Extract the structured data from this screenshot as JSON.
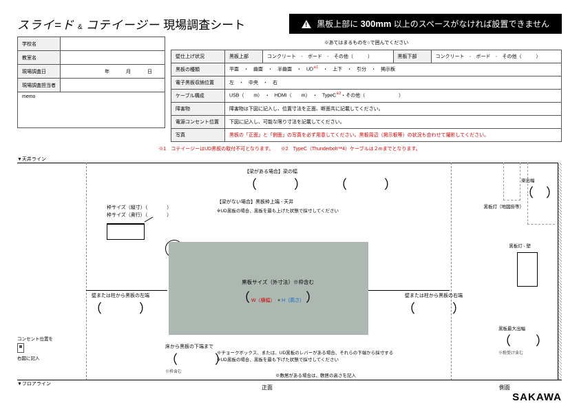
{
  "header": {
    "brand": "スライ=ド",
    "amp": "&",
    "brand2": "コテイージー",
    "subtitle": "現場調査シート",
    "warning_prefix": "黒板上部に",
    "warning_bold": "300mm",
    "warning_suffix": "以上のスペースがなければ設置できません"
  },
  "circle_note": "※あてはまるものを○で囲んでください",
  "left": {
    "school": "学校名",
    "room": "教室名",
    "date": "現場調査日",
    "y": "年",
    "m": "月",
    "d": "日",
    "person": "現場調査担当者",
    "memo": "memo"
  },
  "right": {
    "wall": "壁仕上げ状況",
    "board_top": "黒板上部",
    "board_bot": "黒板下部",
    "opt_concrete": "コンクリート",
    "opt_board": "ボード",
    "opt_other": "その他（",
    "board_type": "黒板の種類",
    "type_opts": "平面　・　曲面　・　半曲面　・　UD",
    "type_opts2": "・　上下　・　引分　・　掲示板",
    "elec": "電子黒板収納位置",
    "elec_opts": "左　・　中央　・　右",
    "cable": "ケーブル構成",
    "cable_opts": "USB（　　m）　・　HDMI（　　m）　・　TypeC",
    "cable_opts2": "・その他（",
    "obstacle": "障害物",
    "obstacle_text": "障害物は下図に記入し、位置寸法を正面、断面共に記載してください。",
    "outlet": "電源コンセント位置",
    "outlet_text": "下図に記入し、可能な限り寸法を記載してください。",
    "photo": "写真",
    "photo_text": "黒板の「正面」と「側面」の写真を必ず用意してください。黒板周辺（掲示板等）の状況も合わせて撮影してください。"
  },
  "fn1": "※1　コテイージーはUD黒板の取付不可となります。",
  "fn2": "※2　TypeC（Thunderbolt™4）ケーブルは２mまでとなります。",
  "diagram": {
    "ceil": "▼天井ライン",
    "floor": "▼フロアライン",
    "frame_h": "枠サイズ（縦寸）（　　　　）",
    "frame_d": "枠サイズ（奥行）（　　　　）",
    "beam_yes": "【梁がある場合】梁の幅",
    "beam_no": "【梁がない場合】黒板枠上端 - 天井",
    "ud_note": "※UD黒板の場合、黒板を最も上げた状態で採寸してください",
    "board_size": "黒板サイズ（外寸法）※枠含む",
    "w": "W（横幅）",
    "h": "H（高さ）",
    "x": "×",
    "left_post": "壁または柱から黒板の左端",
    "right_post": "壁または柱から黒板の右端",
    "floor_to": "床から黒板の下端まで",
    "floor_to_sub": "※枠含む",
    "bot_note": "※チョークボックス、または、UD黒板のレバーがある場合、それらの下端から採寸する\n※UD黒板の場合、黒板を最も下げた状態で採寸してください",
    "dumari": "※敷居がある場合は、敷居の高さを記入",
    "front": "正面",
    "side": "側面",
    "outlet": "コンセント位置を",
    "outlet2": "右図に記入",
    "side_ceil_lbl": "黒板灯（地図掛等）",
    "side_wall_lbl": "黒板灯 - 壁",
    "kb_max": "黒板最大出幅",
    "kb_max_sub": "※粉受け含む",
    "beam_proj": "梁出幅"
  },
  "logo": "SAKAWA"
}
